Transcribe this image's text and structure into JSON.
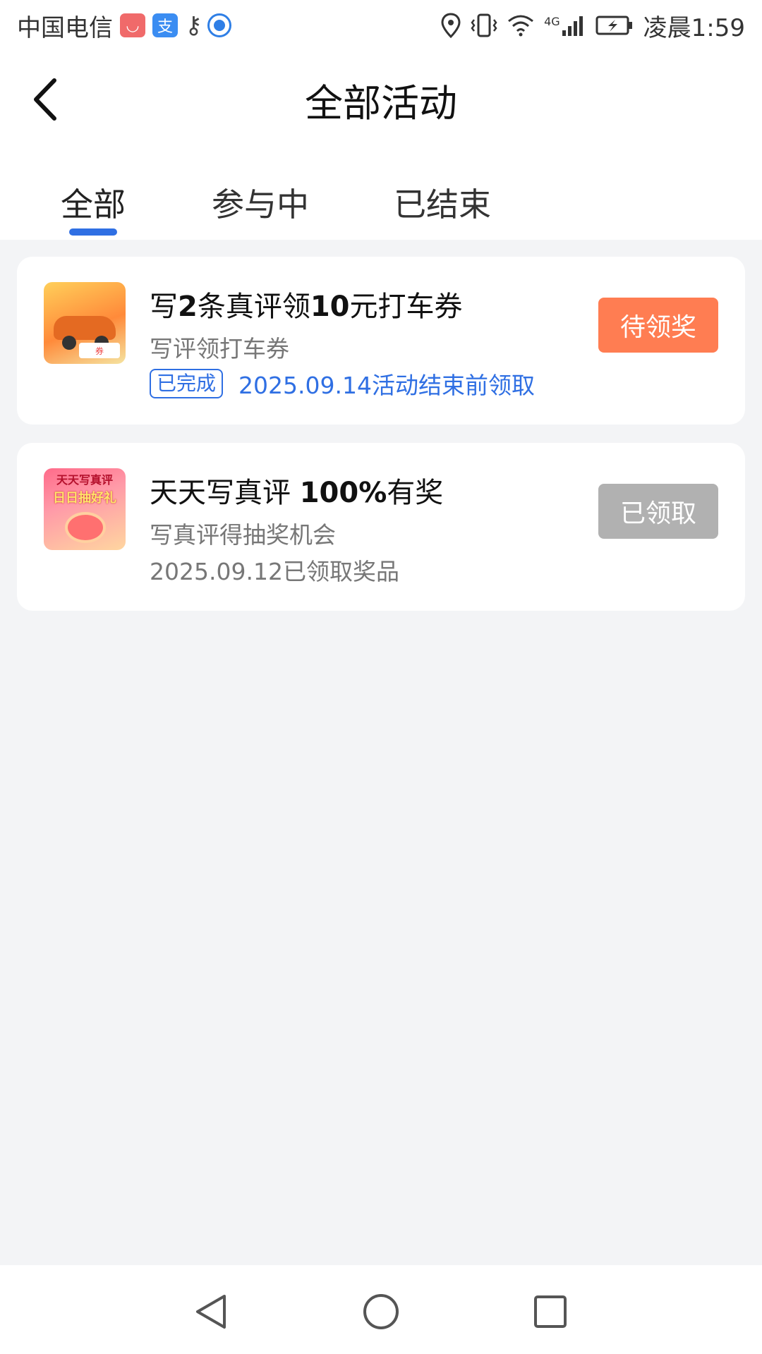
{
  "status_bar": {
    "carrier": "中国电信",
    "huawei_glyph": "◡",
    "alipay_glyph": "支",
    "key_glyph": "⚷",
    "network": "4G",
    "time": "凌晨1:59"
  },
  "header": {
    "title": "全部活动"
  },
  "tabs": [
    {
      "label": "全部",
      "active": true
    },
    {
      "label": "参与中",
      "active": false
    },
    {
      "label": "已结束",
      "active": false
    }
  ],
  "activities": [
    {
      "title_parts": [
        "写",
        "2",
        "条真评领",
        "10",
        "元打车券"
      ],
      "subtitle": "写评领打车券",
      "badge": "已完成",
      "meta": "2025.09.14活动结束前领取",
      "button": "待领奖",
      "thumb_caption": "券",
      "status_color": "#ff7d52"
    },
    {
      "title_parts": [
        "天天写真评 ",
        "100%",
        "有奖"
      ],
      "subtitle": "写真评得抽奖机会",
      "meta": "2025.09.12已领取奖品",
      "button": "已领取",
      "thumb_line1": "天天写真评",
      "thumb_line2": "日日抽好礼",
      "status_color": "#b1b1b1"
    }
  ],
  "colors": {
    "accent": "#2f6fe3",
    "background": "#f3f4f6"
  }
}
